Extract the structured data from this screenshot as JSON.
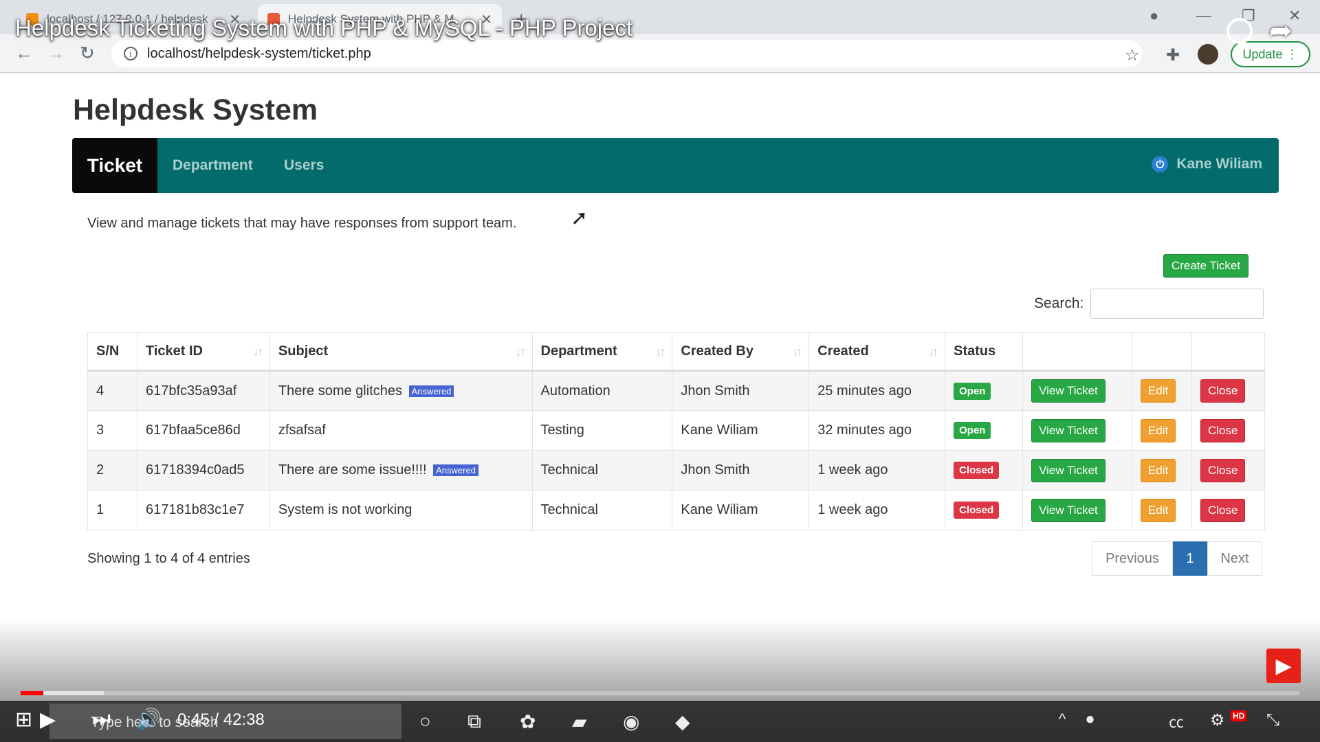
{
  "browser": {
    "tabs": [
      {
        "title": "localhost / 127.0.0.1 / helpdesk"
      },
      {
        "title": "Helpdesk System with PHP & M"
      }
    ],
    "url": "localhost/helpdesk-system/ticket.php",
    "update_label": "Update"
  },
  "video": {
    "title": "Helpdesk Ticketing System with PHP & MySQL - PHP Project",
    "time": "0:45 / 42:38",
    "progress_played": 0.018,
    "progress_buffered": 0.065
  },
  "app": {
    "title": "Helpdesk System",
    "nav": {
      "brand": "Ticket",
      "links": [
        "Department",
        "Users"
      ],
      "user": "Kane Wiliam"
    },
    "intro": "View and manage tickets that may have responses from support team.",
    "create_button": "Create Ticket",
    "search_label": "Search:",
    "table": {
      "headers": [
        "S/N",
        "Ticket ID",
        "Subject",
        "Department",
        "Created By",
        "Created",
        "Status"
      ],
      "rows": [
        {
          "sn": "4",
          "id": "617bfc35a93af",
          "subject": "There some glitches",
          "tag": "Answered",
          "department": "Automation",
          "created_by": "Jhon Smith",
          "created": "25 minutes ago",
          "status": "Open"
        },
        {
          "sn": "3",
          "id": "617bfaa5ce86d",
          "subject": "zfsafsaf",
          "tag": "",
          "department": "Testing",
          "created_by": "Kane Wiliam",
          "created": "32 minutes ago",
          "status": "Open"
        },
        {
          "sn": "2",
          "id": "61718394c0ad5",
          "subject": "There are some issue!!!!",
          "tag": "Answered",
          "department": "Technical",
          "created_by": "Jhon Smith",
          "created": "1 week ago",
          "status": "Closed"
        },
        {
          "sn": "1",
          "id": "617181b83c1e7",
          "subject": "System is not working",
          "tag": "",
          "department": "Technical",
          "created_by": "Kane Wiliam",
          "created": "1 week ago",
          "status": "Closed"
        }
      ],
      "actions": {
        "view": "View Ticket",
        "edit": "Edit",
        "close": "Close"
      }
    },
    "showing": "Showing 1 to 4 of 4 entries",
    "pagination": {
      "previous": "Previous",
      "current": "1",
      "next": "Next"
    }
  },
  "taskbar": {
    "search_placeholder": "Type here to search",
    "hd": "HD"
  },
  "colors": {
    "navbar": "#036b6b",
    "brand_bg": "#0a0a0a",
    "open": "#28a745",
    "closed": "#dc3545",
    "edit": "#f0a030",
    "page_active": "#2a6fb0"
  }
}
